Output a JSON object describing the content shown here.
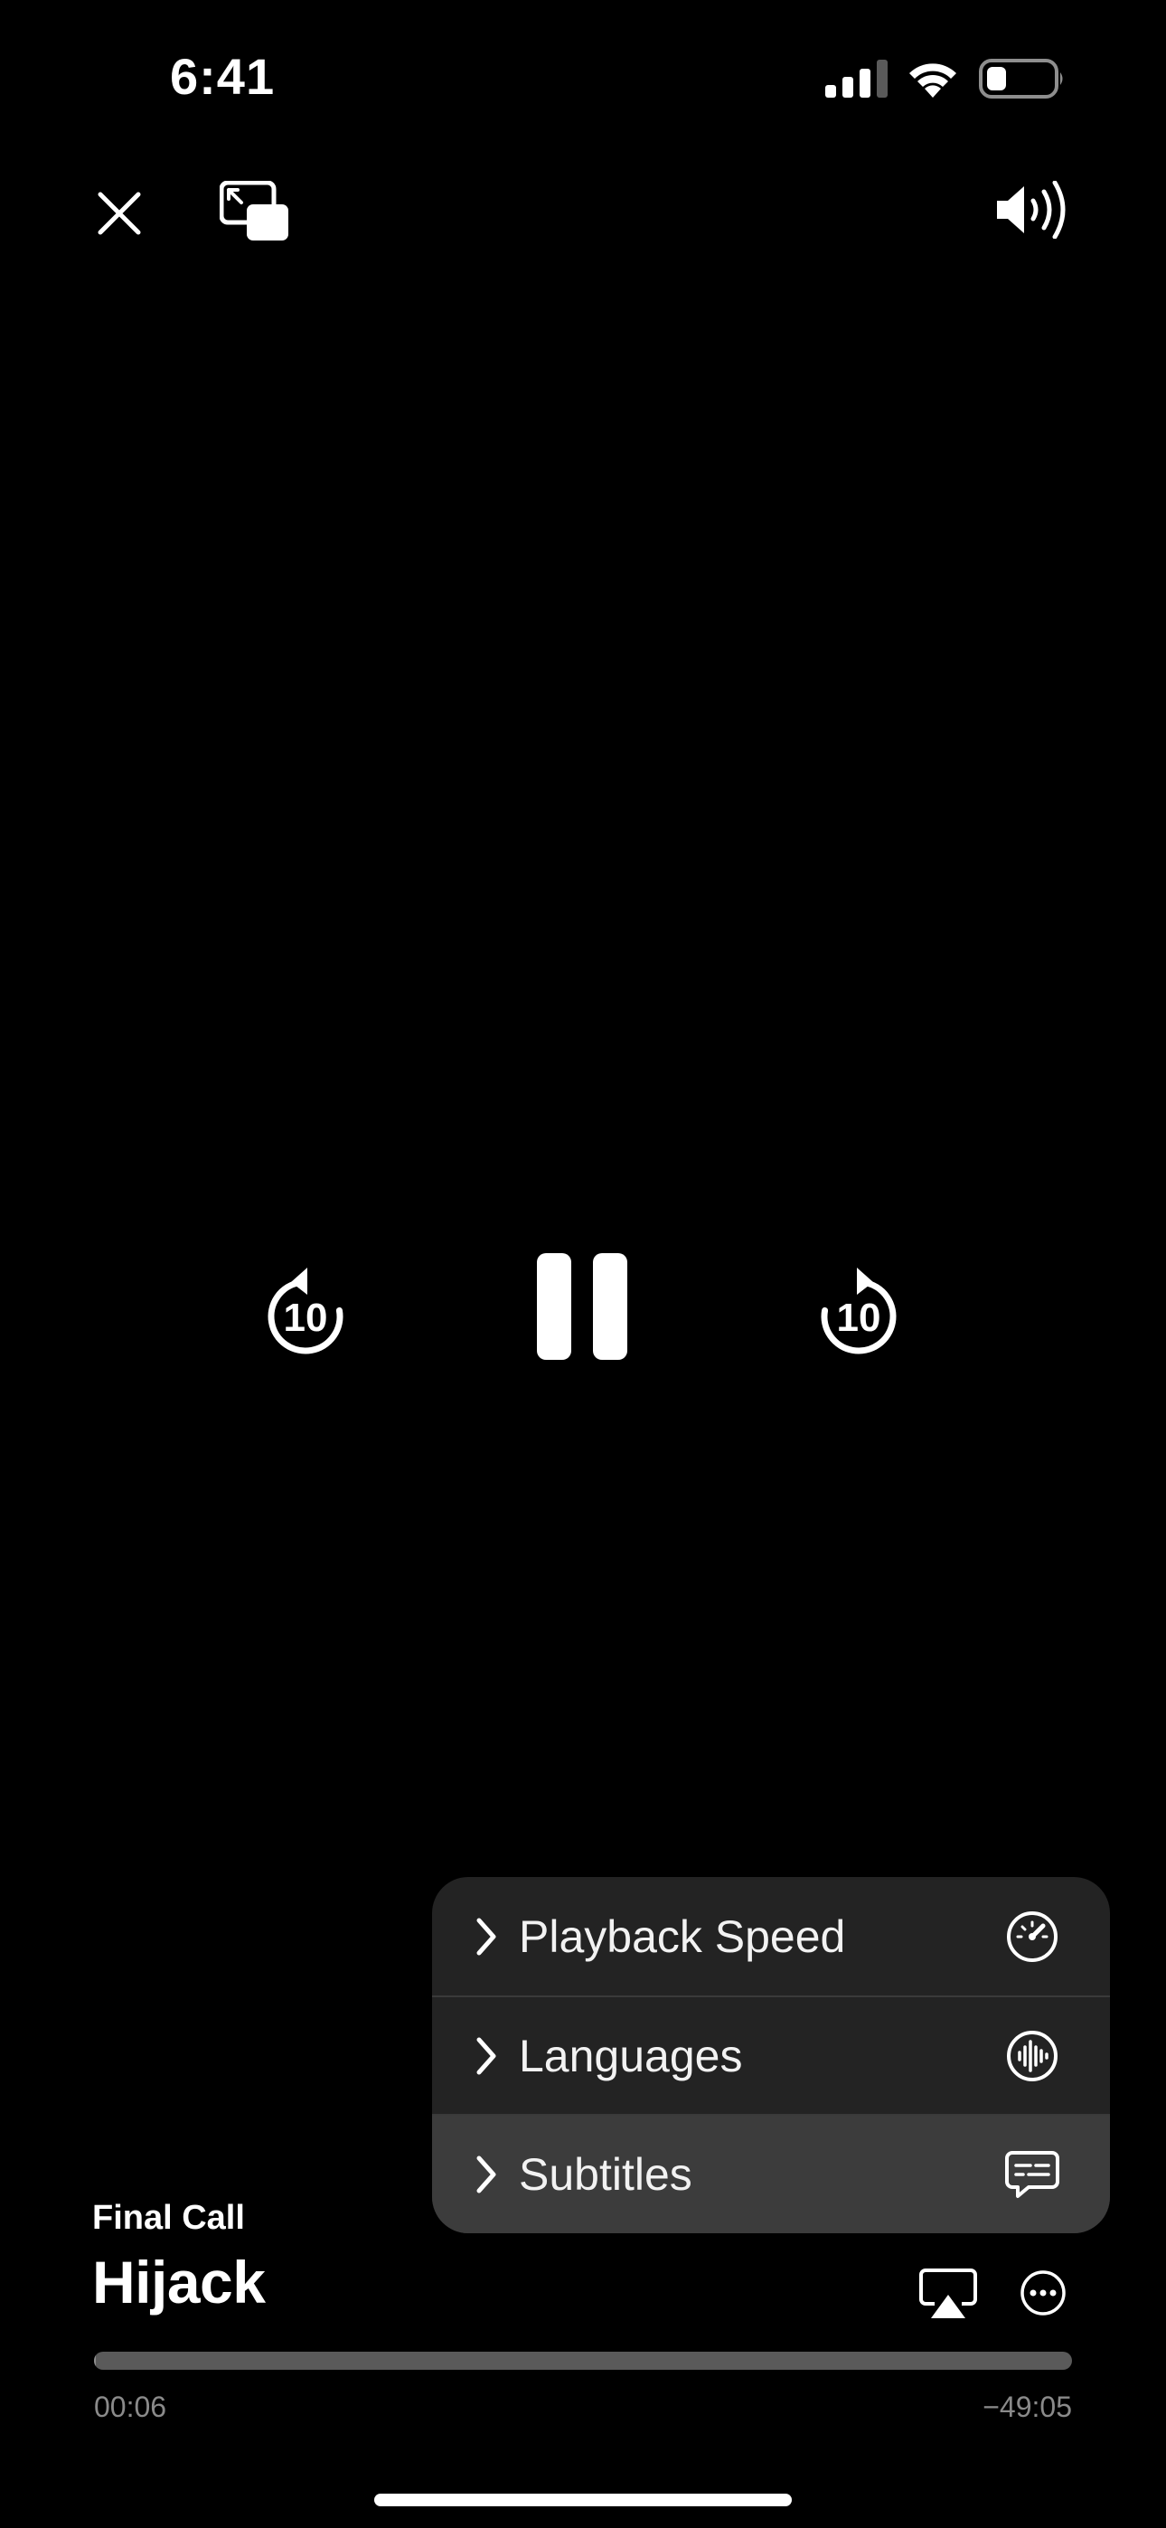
{
  "status_bar": {
    "time": "6:41",
    "signal_icon": "cellular-signal-icon",
    "wifi_icon": "wifi-icon",
    "battery_icon": "battery-icon",
    "battery_level": 0.3
  },
  "top_controls": {
    "close_icon": "close-icon",
    "pip_icon": "picture-in-picture-icon",
    "volume_icon": "speaker-volume-icon"
  },
  "transport": {
    "skip_back_seconds": "10",
    "skip_forward_seconds": "10",
    "state_icon": "pause-icon"
  },
  "menu": {
    "items": [
      {
        "label": "Playback Speed",
        "icon": "speedometer-icon"
      },
      {
        "label": "Languages",
        "icon": "audio-waveform-icon"
      },
      {
        "label": "Subtitles",
        "icon": "subtitles-bubble-icon",
        "highlighted": true
      }
    ]
  },
  "now_playing": {
    "episode": "Final Call",
    "show": "Hijack"
  },
  "bottom_controls": {
    "airplay_icon": "airplay-icon",
    "more_icon": "more-ellipsis-icon"
  },
  "progress": {
    "elapsed": "00:06",
    "remaining": "−49:05",
    "fraction": 0.002
  },
  "colors": {
    "background": "#000000",
    "menu_background": "#232323",
    "menu_highlight": "#3c3c3c",
    "progress_track": "#5a5a5a",
    "secondary_text": "#8a8a8a"
  }
}
